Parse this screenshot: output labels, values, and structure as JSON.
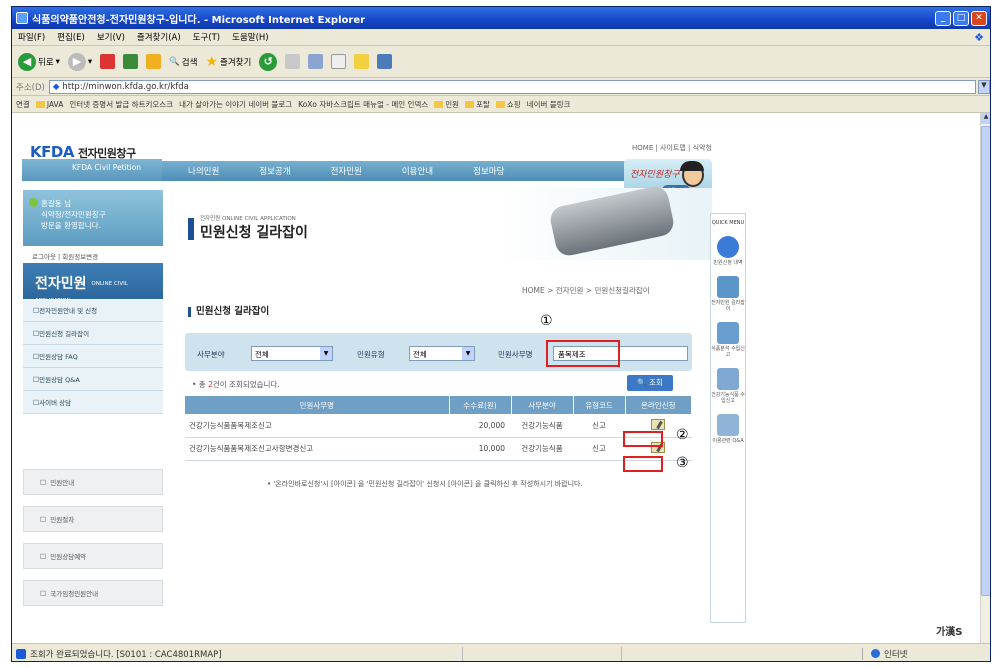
{
  "window": {
    "title": "식품의약품안전청-전자민원창구-입니다. - Microsoft Internet Explorer"
  },
  "menu": [
    "파일(F)",
    "편집(E)",
    "보기(V)",
    "즐겨찾기(A)",
    "도구(T)",
    "도움말(H)"
  ],
  "toolbar": {
    "back": "뒤로",
    "search": "검색",
    "favorites": "즐겨찾기"
  },
  "address": {
    "label": "주소(D)",
    "url": "http://minwon.kfda.go.kr/kfda"
  },
  "links": {
    "label": "연결",
    "items": [
      "JAVA",
      "인터넷 증명서 발급 하트키오스크",
      "내가 살아가는 이야기 네이버 블로그",
      "KoXo 자바스크립트 매뉴얼 - 메인 인덱스",
      "민원",
      "포탈",
      "쇼핑",
      "네이버 블링크"
    ]
  },
  "site": {
    "logo": "KFDA",
    "logo_text": "전자민원창구",
    "logo_eng": "KFDA Civil Petition",
    "top_links": "HOME | 사이트맵 | 식약청",
    "nav": [
      "나의민원",
      "정보공개",
      "전자민원",
      "이용안내",
      "정보마당"
    ],
    "mascot_text": "전자민원창구 상담",
    "mascot_btn": "이용안내",
    "welcome": [
      "홍길동 님",
      "식약청/전자민원창구",
      "방문을 환영합니다."
    ],
    "logout": "로그아웃 | 회원정보변경",
    "left_title": "전자민원",
    "left_title_sub": "ONLINE CIVIL APPLICATION",
    "left_menu": [
      "전자민원안내 및 신청",
      "민원신청 길라잡이",
      "민원상담 FAQ",
      "민원상담 Q&A",
      "사이버 상담"
    ],
    "left_buttons": [
      "민원안내",
      "민원절차",
      "민원상담예약",
      "국가임청민원안내"
    ],
    "banner_en": "전자민원 ONLINE CIVIL APPLICATION",
    "banner_title": "민원신청 길라잡이",
    "breadcrumb": "HOME > 전자민원 > 민원신청길라잡이",
    "section_title": "민원신청 길라잡이"
  },
  "search": {
    "field1_label": "사무분야",
    "field1_value": "전체",
    "field2_label": "민원유형",
    "field2_value": "전체",
    "field3_label": "민원사무명",
    "field3_value": "품목제조",
    "result_prefix": "• 총 ",
    "result_count": "2",
    "result_suffix": "건이 조회되었습니다.",
    "button": "조회"
  },
  "table": {
    "headers": [
      "민원사무명",
      "수수료(원)",
      "사무분야",
      "유형코드",
      "온라인신청"
    ],
    "rows": [
      {
        "name": "건강기능식품품목제조신고",
        "fee": "20,000",
        "field": "건강기능식품",
        "type": "신고"
      },
      {
        "name": "건강기능식품품목제조신고사항변경신고",
        "fee": "10,000",
        "field": "건강기능식품",
        "type": "신고"
      }
    ]
  },
  "notice": "• '온라인바로신청'시 [아이콘] 을 '민원신청 길라잡이' 신청시 [아이콘] 을 클릭하신 후 작성하시기 바랍니다.",
  "quick": {
    "title": "QUICK MENU",
    "items": [
      "민원신청 내역",
      "전자민원 길라잡이",
      "식품분석 수입신고",
      "건강기능식품 수입신고",
      "이용관련 Q&A"
    ]
  },
  "annotations": [
    "①",
    "②",
    "③"
  ],
  "status": {
    "text": "조회가 완료되었습니다. [S0101 : CAC4801RMAP]",
    "zone": "인터넷"
  },
  "ime": "가漢S",
  "colors": {
    "titlebar": "#1647c9",
    "nav": "#5a97bc",
    "highlight": "#e02020"
  }
}
